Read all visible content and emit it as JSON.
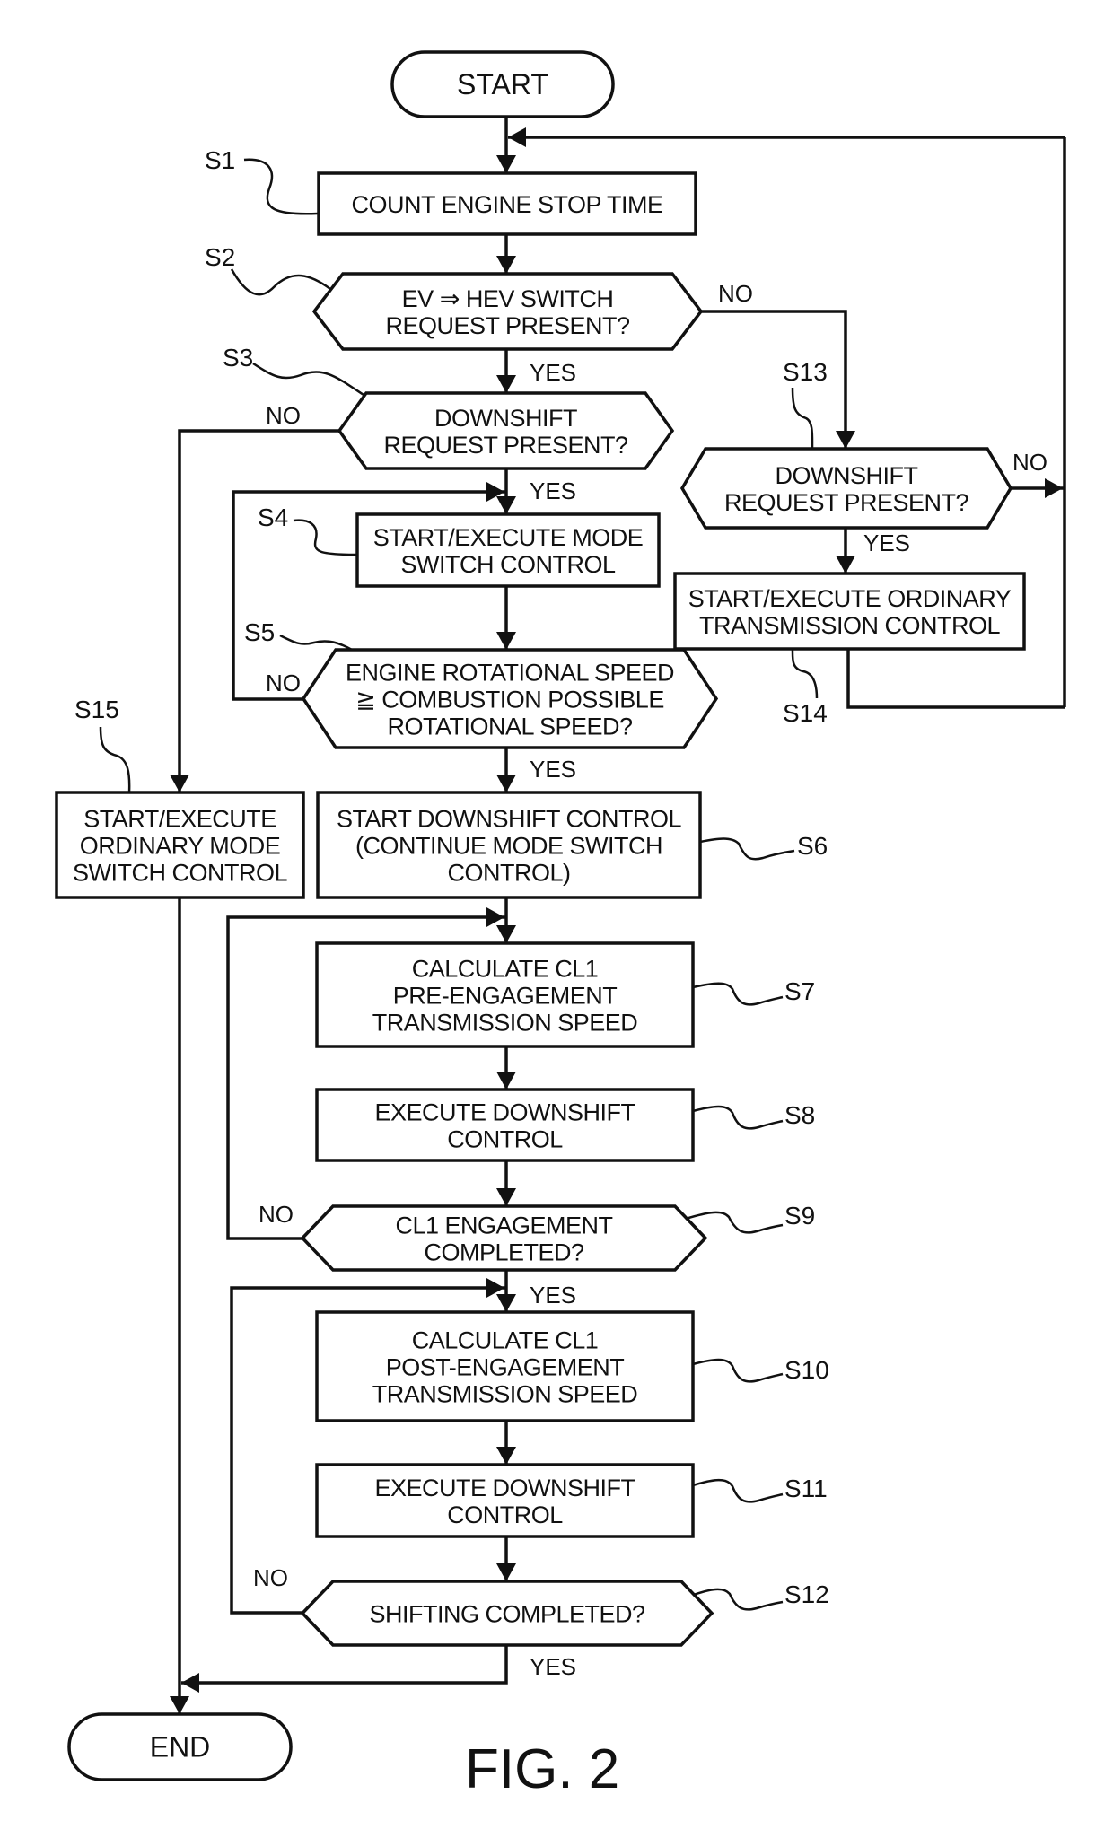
{
  "figure": {
    "title": "FIG. 2",
    "start_label": "START",
    "end_label": "END"
  },
  "steps": {
    "S1": {
      "id": "S1",
      "type": "process",
      "lines": [
        "COUNT ENGINE STOP TIME"
      ]
    },
    "S2": {
      "id": "S2",
      "type": "decision",
      "lines": [
        "EV ⇒ HEV SWITCH",
        "REQUEST PRESENT?"
      ]
    },
    "S3": {
      "id": "S3",
      "type": "decision",
      "lines": [
        "DOWNSHIFT",
        "REQUEST PRESENT?"
      ]
    },
    "S4": {
      "id": "S4",
      "type": "process",
      "lines": [
        "START/EXECUTE MODE",
        "SWITCH CONTROL"
      ]
    },
    "S5": {
      "id": "S5",
      "type": "decision",
      "lines": [
        "ENGINE ROTATIONAL SPEED",
        "≧ COMBUSTION POSSIBLE",
        "ROTATIONAL SPEED?"
      ]
    },
    "S6": {
      "id": "S6",
      "type": "process",
      "lines": [
        "START DOWNSHIFT CONTROL",
        "(CONTINUE MODE SWITCH",
        "CONTROL)"
      ]
    },
    "S7": {
      "id": "S7",
      "type": "process",
      "lines": [
        "CALCULATE CL1",
        "PRE-ENGAGEMENT",
        "TRANSMISSION SPEED"
      ]
    },
    "S8": {
      "id": "S8",
      "type": "process",
      "lines": [
        "EXECUTE DOWNSHIFT",
        "CONTROL"
      ]
    },
    "S9": {
      "id": "S9",
      "type": "decision",
      "lines": [
        "CL1 ENGAGEMENT",
        "COMPLETED?"
      ]
    },
    "S10": {
      "id": "S10",
      "type": "process",
      "lines": [
        "CALCULATE CL1",
        "POST-ENGAGEMENT",
        "TRANSMISSION SPEED"
      ]
    },
    "S11": {
      "id": "S11",
      "type": "process",
      "lines": [
        "EXECUTE DOWNSHIFT",
        "CONTROL"
      ]
    },
    "S12": {
      "id": "S12",
      "type": "decision",
      "lines": [
        "SHIFTING COMPLETED?"
      ]
    },
    "S13": {
      "id": "S13",
      "type": "decision",
      "lines": [
        "DOWNSHIFT",
        "REQUEST PRESENT?"
      ]
    },
    "S14": {
      "id": "S14",
      "type": "process",
      "lines": [
        "START/EXECUTE ORDINARY",
        "TRANSMISSION CONTROL"
      ]
    },
    "S15": {
      "id": "S15",
      "type": "process",
      "lines": [
        "START/EXECUTE",
        "ORDINARY MODE",
        "SWITCH CONTROL"
      ]
    }
  },
  "branches": {
    "yes": "YES",
    "no": "NO"
  },
  "edges": [
    {
      "from": "START",
      "to": "S1",
      "label": ""
    },
    {
      "from": "S1",
      "to": "S2",
      "label": ""
    },
    {
      "from": "S2",
      "to": "S3",
      "label": "YES"
    },
    {
      "from": "S2",
      "to": "S13",
      "label": "NO"
    },
    {
      "from": "S3",
      "to": "S4",
      "label": "YES"
    },
    {
      "from": "S3",
      "to": "S15",
      "label": "NO"
    },
    {
      "from": "S4",
      "to": "S5",
      "label": ""
    },
    {
      "from": "S5",
      "to": "S6",
      "label": "YES"
    },
    {
      "from": "S5",
      "to": "S4",
      "label": "NO"
    },
    {
      "from": "S6",
      "to": "S7",
      "label": ""
    },
    {
      "from": "S7",
      "to": "S8",
      "label": ""
    },
    {
      "from": "S8",
      "to": "S9",
      "label": ""
    },
    {
      "from": "S9",
      "to": "S10",
      "label": "YES"
    },
    {
      "from": "S9",
      "to": "S7",
      "label": "NO"
    },
    {
      "from": "S10",
      "to": "S11",
      "label": ""
    },
    {
      "from": "S11",
      "to": "S12",
      "label": ""
    },
    {
      "from": "S12",
      "to": "END",
      "label": "YES"
    },
    {
      "from": "S12",
      "to": "S10",
      "label": "NO"
    },
    {
      "from": "S13",
      "to": "S14",
      "label": "YES"
    },
    {
      "from": "S13",
      "to": "S1",
      "label": "NO"
    },
    {
      "from": "S14",
      "to": "S1",
      "label": ""
    },
    {
      "from": "S15",
      "to": "END",
      "label": ""
    }
  ]
}
